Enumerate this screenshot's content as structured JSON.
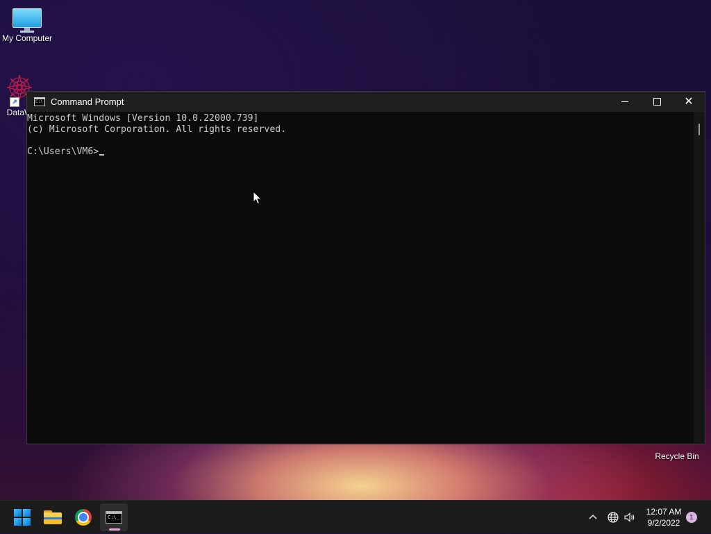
{
  "desktop": {
    "icons": [
      {
        "label": "My Computer"
      },
      {
        "label": "DataW"
      },
      {
        "label": "Recycle Bin"
      }
    ]
  },
  "cmd_window": {
    "title": "Command Prompt",
    "lines": [
      "Microsoft Windows [Version 10.0.22000.739]",
      "(c) Microsoft Corporation. All rights reserved.",
      "",
      "C:\\Users\\VM6>"
    ]
  },
  "taskbar": {
    "apps": [
      {
        "name": "start",
        "icon": "windows-logo-icon"
      },
      {
        "name": "file-explorer",
        "icon": "folder-icon"
      },
      {
        "name": "chrome",
        "icon": "chrome-icon"
      },
      {
        "name": "command-prompt",
        "icon": "cmd-icon",
        "active": true
      }
    ],
    "tray": {
      "time": "12:07 AM",
      "date": "9/2/2022",
      "notification_count": "1"
    }
  },
  "colors": {
    "accent": "#0078d4",
    "console_text": "#cccccc",
    "console_bg": "#0c0c0c",
    "active_indicator": "#e8a8d8"
  }
}
